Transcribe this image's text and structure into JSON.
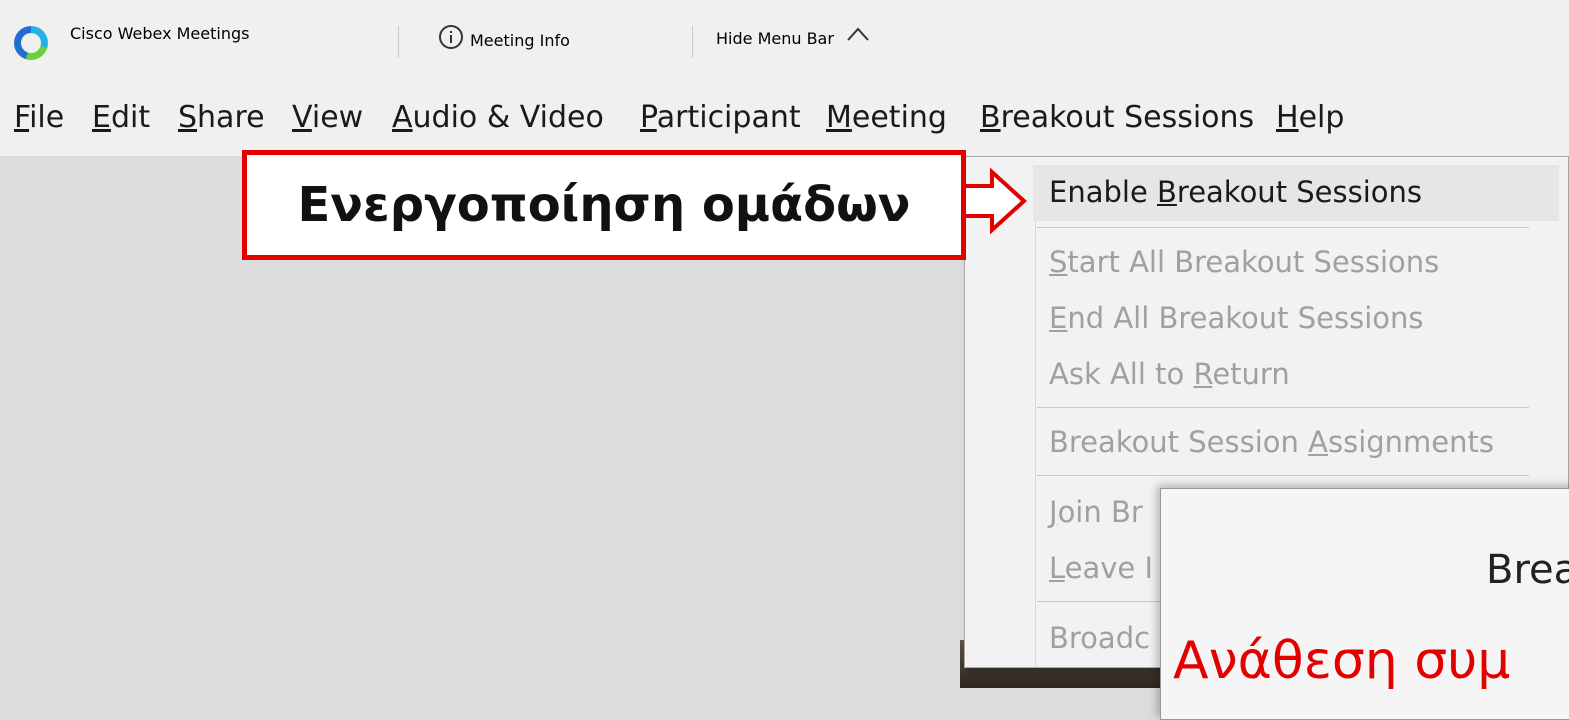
{
  "titlebar": {
    "app_name": "Cisco Webex Meetings",
    "meeting_info": "Meeting Info",
    "hide_menu_bar": "Hide Menu Bar"
  },
  "menubar": {
    "items": [
      {
        "underline": "F",
        "rest": "ile"
      },
      {
        "underline": "E",
        "rest": "dit"
      },
      {
        "underline": "S",
        "rest": "hare"
      },
      {
        "underline": "V",
        "rest": "iew"
      },
      {
        "underline": "A",
        "rest": "udio & Video"
      },
      {
        "underline": "P",
        "rest": "articipant"
      },
      {
        "underline": "M",
        "rest": "eeting"
      },
      {
        "underline": "B",
        "rest": "reakout Sessions"
      },
      {
        "underline": "H",
        "rest": "elp"
      }
    ]
  },
  "callout": {
    "text": "Ενεργοποίηση ομάδων"
  },
  "dropdown": {
    "items": [
      {
        "pre": "Enable ",
        "u": "B",
        "post": "reakout Sessions",
        "enabled": true
      },
      {
        "pre": "",
        "u": "S",
        "post": "tart All Breakout Sessions",
        "enabled": false
      },
      {
        "pre": "",
        "u": "E",
        "post": "nd All Breakout Sessions",
        "enabled": false
      },
      {
        "pre": "Ask All to ",
        "u": "R",
        "post": "eturn",
        "enabled": false
      },
      {
        "pre": "Breakout Session ",
        "u": "A",
        "post": "ssignments",
        "enabled": false
      },
      {
        "pre": "",
        "u": "J",
        "post": "oin Br",
        "enabled": false
      },
      {
        "pre": "",
        "u": "L",
        "post": "eave I",
        "enabled": false
      },
      {
        "pre": "Broadc",
        "u": "",
        "post": "",
        "enabled": false
      }
    ]
  },
  "dialog": {
    "title_fragment": "Brea",
    "red_text_fragment": "Ανάθεση   συμ"
  },
  "colors": {
    "callout_border": "#e30000",
    "menu_bg": "#f0f0f0",
    "disabled_text": "#a0a0a0"
  }
}
